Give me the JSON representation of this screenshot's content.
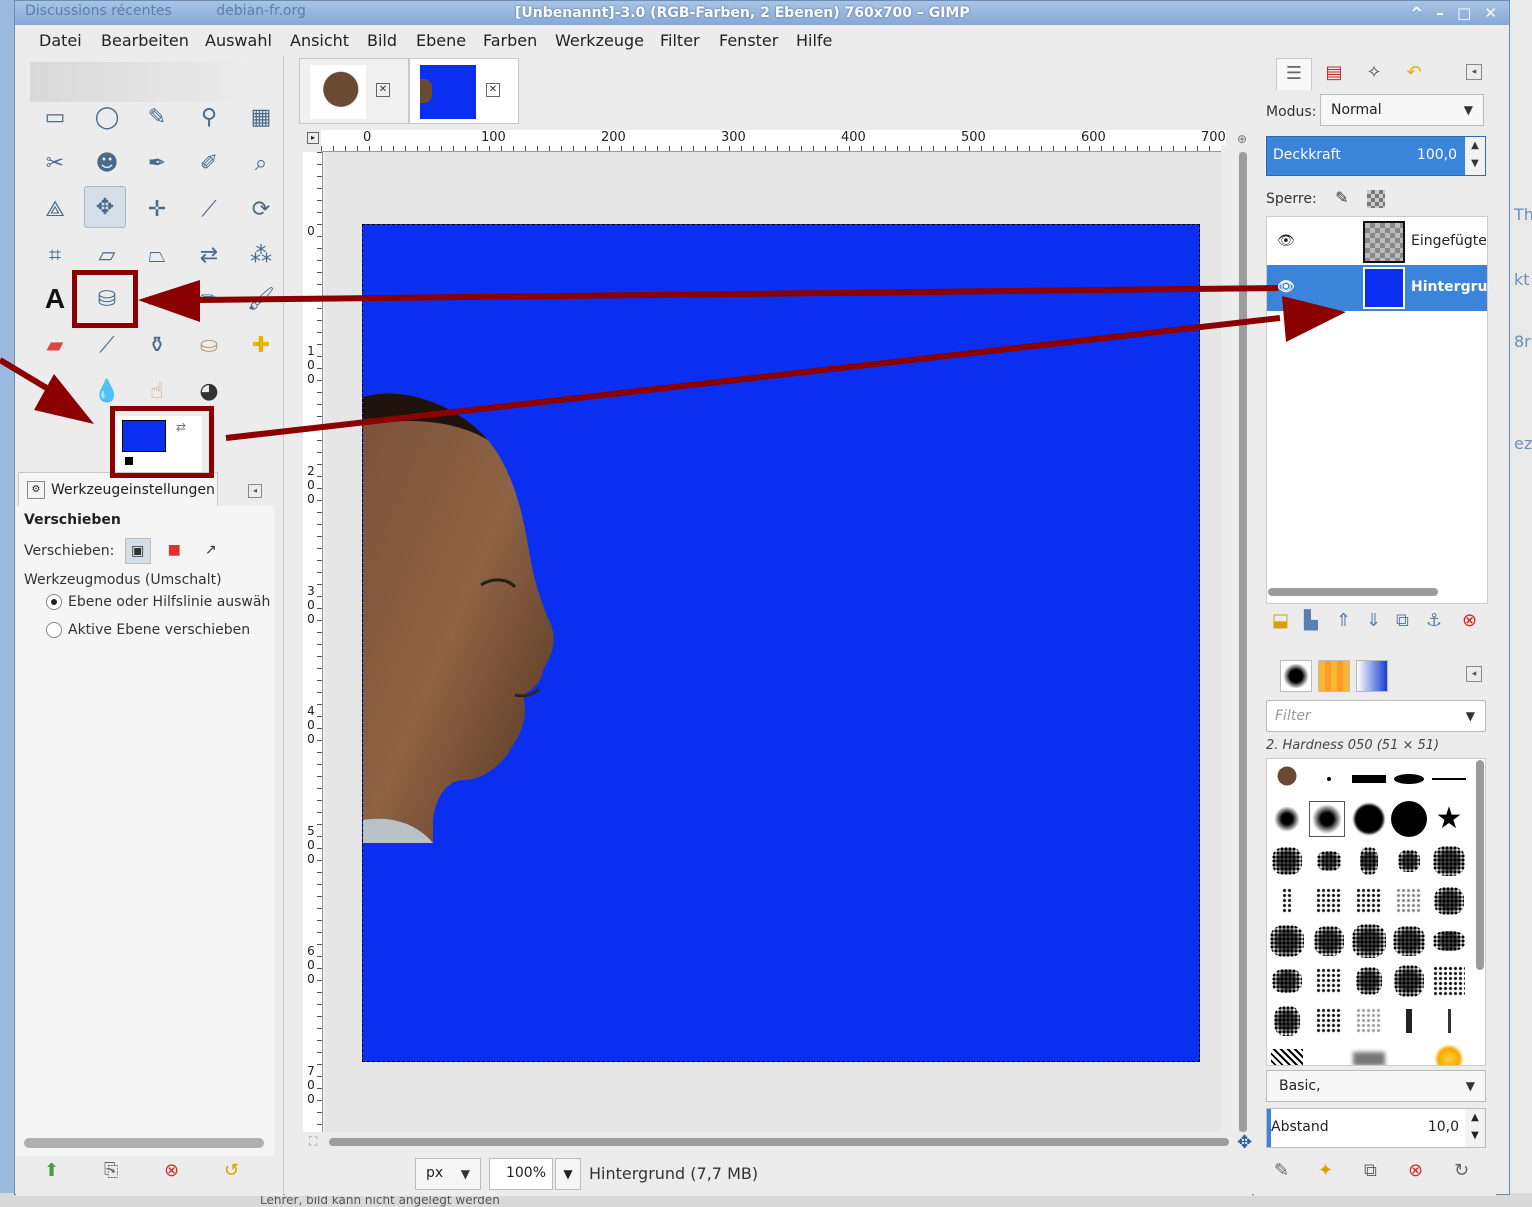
{
  "background": {
    "right_fragments": [
      "Th",
      "kt",
      "8r",
      "ez"
    ],
    "bottom_text": "Lehrer, bild kann nicht angelegt werden"
  },
  "titlebar": {
    "browser_tabs": [
      "Discussions récentes",
      "debian-fr.org"
    ],
    "title": "[Unbenannt]-3.0 (RGB-Farben, 2 Ebenen) 760x700 – GIMP",
    "window_buttons": "^ – □ ✕"
  },
  "menubar": {
    "items": [
      "Datei",
      "Bearbeiten",
      "Auswahl",
      "Ansicht",
      "Bild",
      "Ebene",
      "Farben",
      "Werkzeuge",
      "Filter",
      "Fenster",
      "Hilfe"
    ]
  },
  "toolbox": {
    "text_tool_glyph": "A",
    "tool_options_tab": "Werkzeugeinstellungen",
    "options_heading": "Verschieben",
    "move_label": "Verschieben:",
    "mode_label": "Werkzeugmodus (Umschalt)",
    "radio_1": "Ebene oder Hilfslinie auswäh",
    "radio_2": "Aktive Ebene verschieben",
    "foreground_color": "#0a2ff0",
    "background_color": "#ffffff"
  },
  "image": {
    "ruler_top": [
      "0",
      "100",
      "200",
      "300",
      "400",
      "500",
      "600",
      "700"
    ],
    "ruler_left": [
      "0",
      "100",
      "200",
      "300",
      "400",
      "500",
      "600",
      "700"
    ],
    "unit": "px",
    "zoom": "100%",
    "status": "Hintergrund (7,7 MB)",
    "canvas_color": "#0a2ff0"
  },
  "dock": {
    "mode_label": "Modus:",
    "mode_value": "Normal",
    "opacity_label": "Deckkraft",
    "opacity_value": "100,0",
    "lock_label": "Sperre:",
    "layers": [
      {
        "name": "Eingefügte",
        "selected": false
      },
      {
        "name": "Hintergrund",
        "selected": true
      }
    ],
    "filter_placeholder": "Filter",
    "brush_title": "2. Hardness 050 (51 × 51)",
    "preset": "Basic,",
    "spacing_label": "Abstand",
    "spacing_value": "10,0"
  },
  "annotation_color": "#8b0000"
}
